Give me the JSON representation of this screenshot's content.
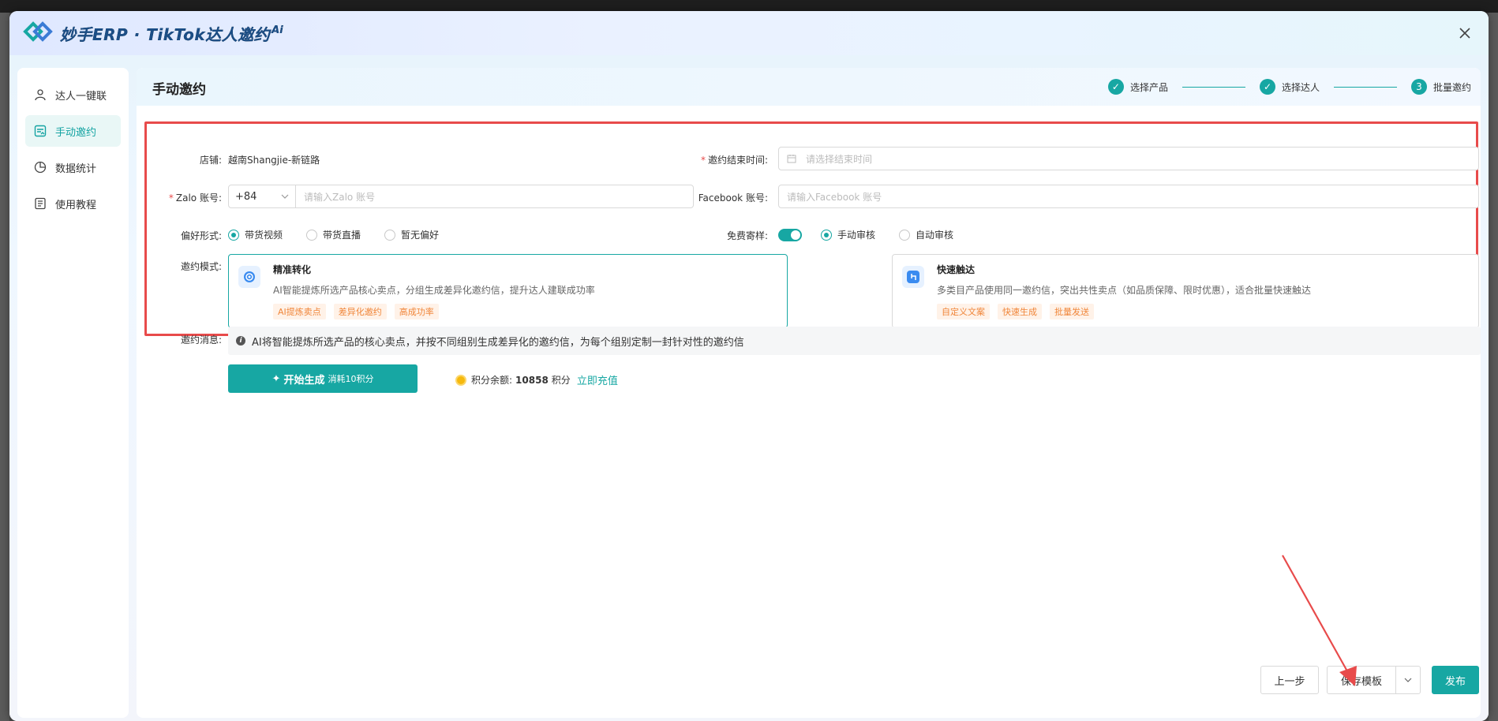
{
  "app": {
    "brand": "妙手ERP · TikTok达人邀约",
    "brand_sup": "Ai"
  },
  "sidebar": {
    "items": [
      {
        "label": "达人一键联",
        "icon": "user-icon"
      },
      {
        "label": "手动邀约",
        "icon": "invite-icon",
        "active": true
      },
      {
        "label": "数据统计",
        "icon": "pie-chart-icon"
      },
      {
        "label": "使用教程",
        "icon": "book-icon"
      }
    ]
  },
  "page": {
    "title": "手动邀约"
  },
  "steps": [
    {
      "label": "选择产品",
      "state": "done"
    },
    {
      "label": "选择达人",
      "state": "done"
    },
    {
      "label": "批量邀约",
      "num": "3",
      "state": "current"
    }
  ],
  "form": {
    "store_label": "店铺:",
    "store_value": "越南Shangjie-新链路",
    "end_time_label": "邀约结束时间:",
    "end_time_placeholder": "请选择结束时间",
    "zalo_label": "Zalo 账号:",
    "zalo_code": "+84",
    "zalo_placeholder": "请输入Zalo 账号",
    "facebook_label": "Facebook 账号:",
    "facebook_placeholder": "请输入Facebook 账号",
    "pref_label": "偏好形式:",
    "pref_options": [
      "带货视频",
      "带货直播",
      "暂无偏好"
    ],
    "sample_label": "免费寄样:",
    "sample_options": [
      "手动审核",
      "自动审核"
    ],
    "mode_label": "邀约模式:",
    "modes": [
      {
        "title": "精准转化",
        "desc": "AI智能提炼所选产品核心卖点，分组生成差异化邀约信，提升达人建联成功率",
        "tags": [
          "AI提炼卖点",
          "差异化邀约",
          "高成功率"
        ],
        "icon": "target-icon"
      },
      {
        "title": "快速触达",
        "desc": "多类目产品使用同一邀约信，突出共性卖点（如品质保障、限时优惠），适合批量快速触达",
        "tags": [
          "自定义文案",
          "快速生成",
          "批量发送"
        ],
        "icon": "touch-icon"
      }
    ],
    "msg_label": "邀约消息:",
    "msg_info": "AI将智能提炼所选产品的核心卖点，并按不同组别生成差异化的邀约信，为每个组别定制一封针对性的邀约信"
  },
  "generate": {
    "label": "开始生成",
    "sub": "消耗10积分",
    "points_label": "积分余额:",
    "points_value": "10858",
    "points_unit": "积分",
    "recharge": "立即充值"
  },
  "footer": {
    "prev": "上一步",
    "save_template": "保存模板",
    "publish": "发布"
  },
  "colors": {
    "accent": "#17a7a3",
    "highlight": "#e84b4b",
    "tag_text": "#f0863a"
  }
}
